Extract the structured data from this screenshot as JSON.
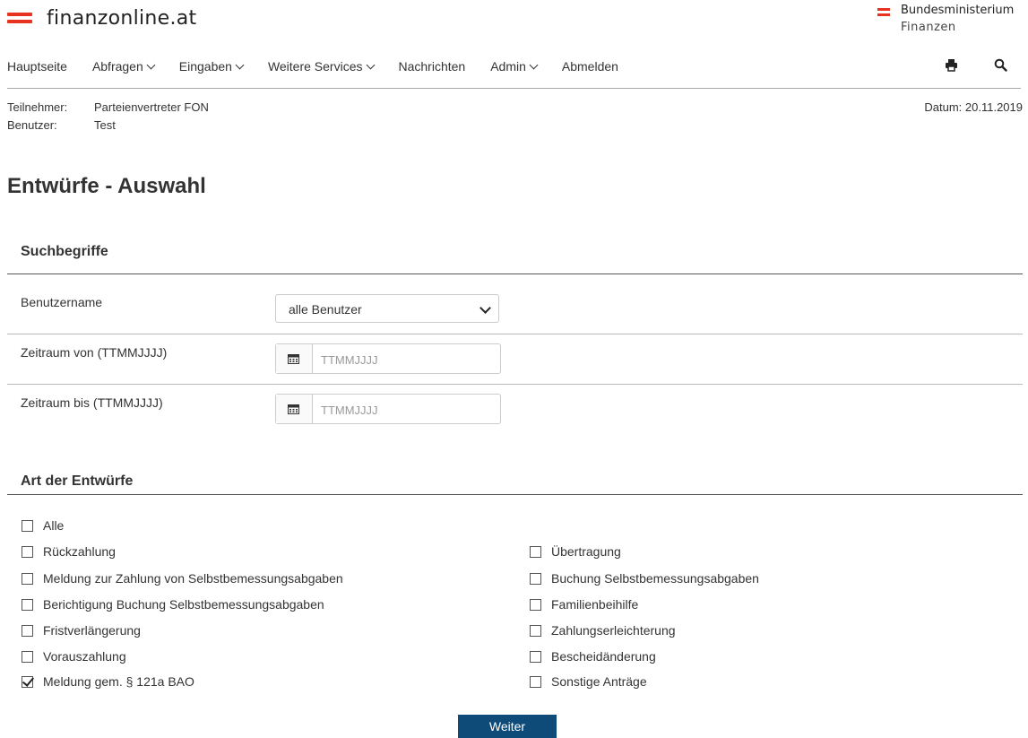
{
  "header": {
    "logo_text": "finanzonline.at",
    "ministry_line1": "Bundesministerium",
    "ministry_line2": "Finanzen",
    "brand_red": "#e6321e"
  },
  "nav": {
    "items": [
      {
        "label": "Hauptseite",
        "dropdown": false
      },
      {
        "label": "Abfragen",
        "dropdown": true
      },
      {
        "label": "Eingaben",
        "dropdown": true
      },
      {
        "label": "Weitere Services",
        "dropdown": true
      },
      {
        "label": "Nachrichten",
        "dropdown": false
      },
      {
        "label": "Admin",
        "dropdown": true
      },
      {
        "label": "Abmelden",
        "dropdown": false
      }
    ],
    "icons": [
      "print-icon",
      "search-icon"
    ]
  },
  "info": {
    "teilnehmer_label": "Teilnehmer:",
    "teilnehmer_value": "Parteienvertreter FON",
    "benutzer_label": "Benutzer:",
    "benutzer_value": "Test",
    "datum": "Datum: 20.11.2019"
  },
  "page_title": "Entwürfe - Auswahl",
  "search": {
    "section_title": "Suchbegriffe",
    "benutzername_label": "Benutzername",
    "benutzername_value": "alle Benutzer",
    "von_label": "Zeitraum von (TTMMJJJJ)",
    "von_placeholder": "TTMMJJJJ",
    "bis_label": "Zeitraum bis (TTMMJJJJ)",
    "bis_placeholder": "TTMMJJJJ"
  },
  "types": {
    "section_title": "Art der Entwürfe",
    "all": {
      "label": "Alle",
      "checked": false
    },
    "left": [
      {
        "label": "Rückzahlung",
        "checked": false
      },
      {
        "label": "Meldung zur Zahlung von Selbstbemessungsabgaben",
        "checked": false
      },
      {
        "label": "Berichtigung Buchung Selbstbemessungsabgaben",
        "checked": false
      },
      {
        "label": "Fristverlängerung",
        "checked": false
      },
      {
        "label": "Vorauszahlung",
        "checked": false
      },
      {
        "label": "Meldung gem. § 121a BAO",
        "checked": true
      }
    ],
    "right": [
      {
        "label": "Übertragung",
        "checked": false
      },
      {
        "label": "Buchung Selbstbemessungsabgaben",
        "checked": false
      },
      {
        "label": "Familienbeihilfe",
        "checked": false
      },
      {
        "label": "Zahlungserleichterung",
        "checked": false
      },
      {
        "label": "Bescheidänderung",
        "checked": false
      },
      {
        "label": "Sonstige Anträge",
        "checked": false
      }
    ]
  },
  "submit_label": "Weiter",
  "button_color": "#0e4b78"
}
